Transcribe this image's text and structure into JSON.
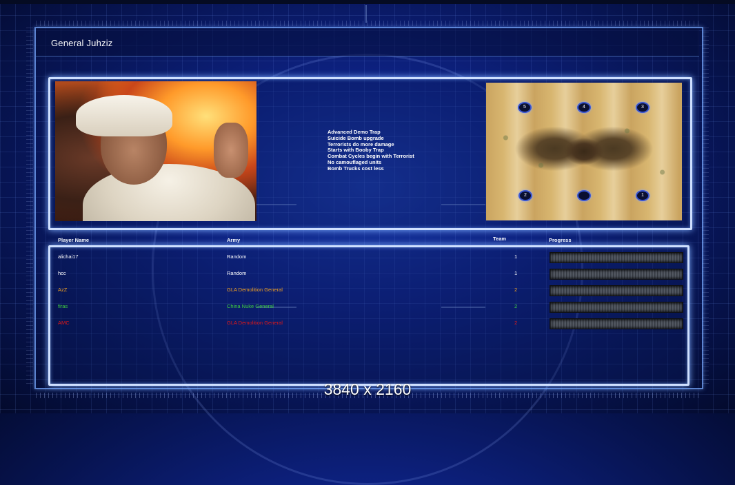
{
  "header": {
    "title": "General Juhziz"
  },
  "generalBonuses": [
    "Advanced Demo Trap",
    "Suicide Bomb upgrade",
    "Terrorists do more damage",
    "Starts with Booby Trap",
    "Combat Cycles begin with Terrorist",
    "No camouflaged units",
    "Bomb Trucks cost less"
  ],
  "map": {
    "spawns": [
      {
        "label": "5"
      },
      {
        "label": "4"
      },
      {
        "label": "3"
      },
      {
        "label": "2"
      },
      {
        "label": ""
      },
      {
        "label": "1"
      }
    ]
  },
  "table": {
    "headers": {
      "player": "Player Name",
      "army": "Army",
      "team": "Team",
      "progress": "Progress"
    },
    "rows": [
      {
        "player": "alichai17",
        "army": "Random",
        "team": "1",
        "color": "#ffffff",
        "progress": 0
      },
      {
        "player": "hcc",
        "army": "Random",
        "team": "1",
        "color": "#ffffff",
        "progress": 0
      },
      {
        "player": "AzZ",
        "army": "GLA Demolition General",
        "team": "2",
        "color": "#f0a020",
        "progress": 0
      },
      {
        "player": "firas",
        "army": "China Nuke General",
        "team": "2",
        "color": "#40d040",
        "progress": 0
      },
      {
        "player": "AMC",
        "army": "GLA Demolition General",
        "team": "2",
        "color": "#e01818",
        "progress": 0
      }
    ]
  },
  "overlay": {
    "resolution": "3840 x 2160"
  },
  "colors": {
    "panelBorder": "#cfe0ff",
    "background": "#0d2180"
  }
}
